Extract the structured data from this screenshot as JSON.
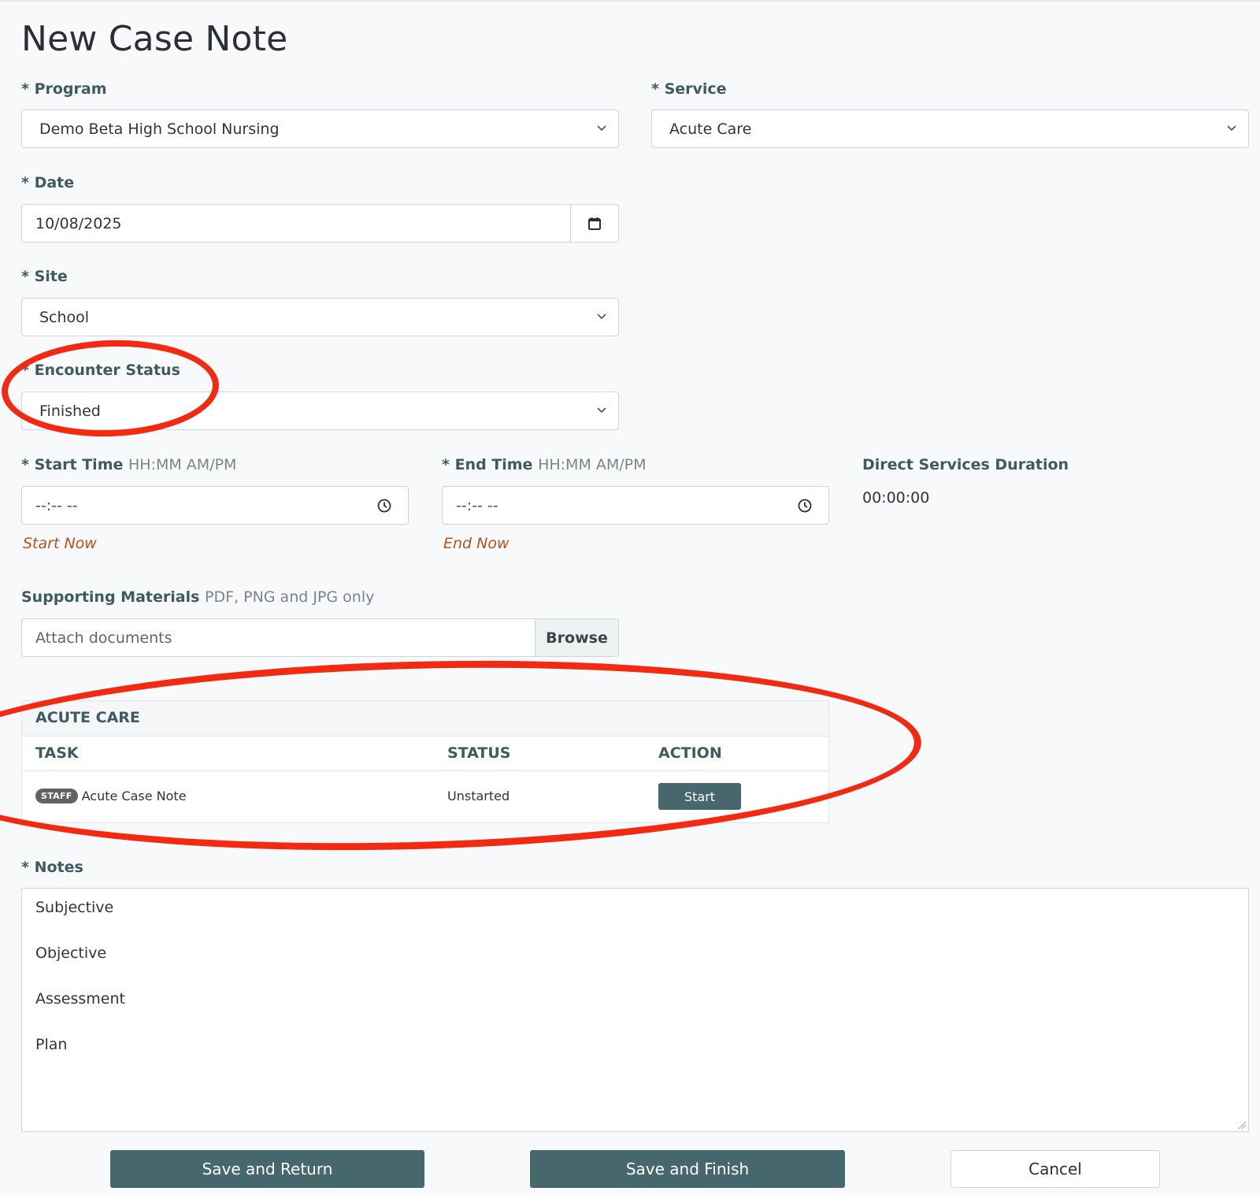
{
  "page": {
    "title": "New Case Note"
  },
  "form": {
    "program": {
      "label": "Program",
      "value": "Demo Beta High School Nursing"
    },
    "service": {
      "label": "Service",
      "value": "Acute Care"
    },
    "date": {
      "label": "Date",
      "value": "10/08/2025"
    },
    "site": {
      "label": "Site",
      "value": "School"
    },
    "encounter_status": {
      "label": "Encounter Status",
      "value": "Finished"
    },
    "start_time": {
      "label": "Start Time",
      "hint": "HH:MM AM/PM",
      "value": "--:-- --",
      "link": "Start Now"
    },
    "end_time": {
      "label": "End Time",
      "hint": "HH:MM AM/PM",
      "value": "--:-- --",
      "link": "End Now"
    },
    "duration": {
      "label": "Direct Services Duration",
      "value": "00:00:00"
    },
    "supporting_materials": {
      "label": "Supporting Materials",
      "hint": "PDF, PNG and JPG only",
      "placeholder": "Attach documents",
      "browse_label": "Browse"
    },
    "required_mark": "*"
  },
  "tasks": {
    "section_title": "ACUTE CARE",
    "columns": [
      "TASK",
      "STATUS",
      "ACTION"
    ],
    "rows": [
      {
        "badge": "STAFF",
        "task": "Acute Case Note",
        "status": "Unstarted",
        "action": "Start"
      }
    ]
  },
  "notes": {
    "label": "Notes",
    "lines": [
      "Subjective",
      "Objective",
      "Assessment",
      "Plan"
    ]
  },
  "buttons": {
    "save_return": "Save and Return",
    "save_finish": "Save and Finish",
    "cancel": "Cancel"
  },
  "colors": {
    "primary": "#46676c",
    "label": "#3f5a60",
    "link": "#b5511c",
    "annotation": "#f22a12"
  }
}
